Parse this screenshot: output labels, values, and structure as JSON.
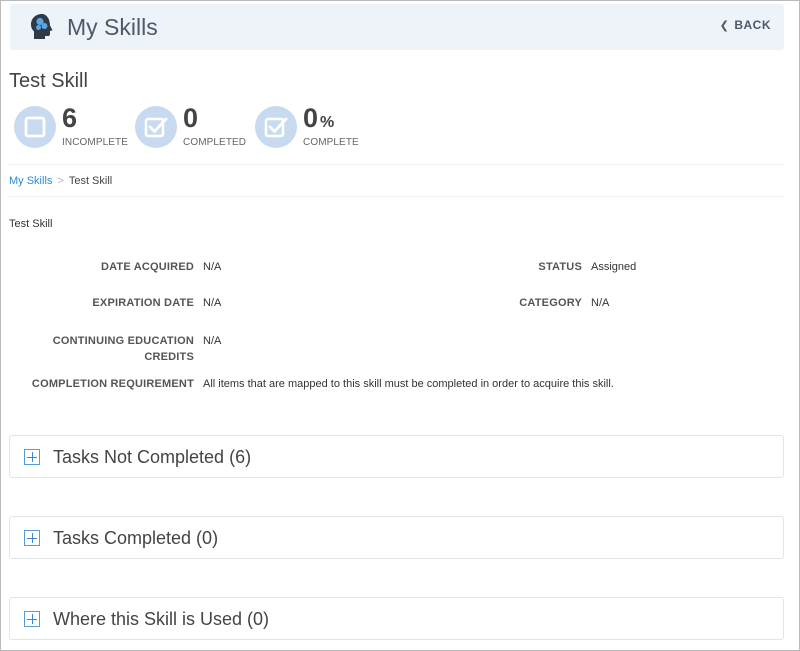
{
  "header": {
    "app_title": "My Skills",
    "back_label": "BACK",
    "head_icon": "brain-head-icon"
  },
  "skill": {
    "title": "Test Skill",
    "description": "Test Skill"
  },
  "stats": [
    {
      "value": "6",
      "suffix": "",
      "label": "INCOMPLETE",
      "icon": "square-icon"
    },
    {
      "value": "0",
      "suffix": "",
      "label": "COMPLETED",
      "icon": "checkbox-icon"
    },
    {
      "value": "0",
      "suffix": "%",
      "label": "COMPLETE",
      "icon": "checkbox-icon"
    }
  ],
  "breadcrumb": {
    "root": "My Skills",
    "separator": ">",
    "current": "Test Skill"
  },
  "details": {
    "date_acquired": {
      "label": "DATE ACQUIRED",
      "value": "N/A"
    },
    "status": {
      "label": "STATUS",
      "value": "Assigned"
    },
    "expiration_date": {
      "label": "EXPIRATION DATE",
      "value": "N/A"
    },
    "category": {
      "label": "CATEGORY",
      "value": "N/A"
    },
    "continuing_education_credits": {
      "label_line1": "CONTINUING EDUCATION",
      "label_line2": "CREDITS",
      "value": "N/A"
    },
    "completion_requirement": {
      "label": "COMPLETION REQUIREMENT",
      "value": "All items that are mapped to this skill must be completed in order to acquire this skill."
    }
  },
  "panels": [
    {
      "label": "Tasks Not Completed (6)"
    },
    {
      "label": "Tasks Completed (0)"
    },
    {
      "label": "Where this Skill is Used (0)"
    }
  ],
  "colors": {
    "accent": "#2a8bd6",
    "header_bg": "#eef3fa",
    "stat_circle": "#c8daf0",
    "plus_icon": "#3a86cf"
  }
}
